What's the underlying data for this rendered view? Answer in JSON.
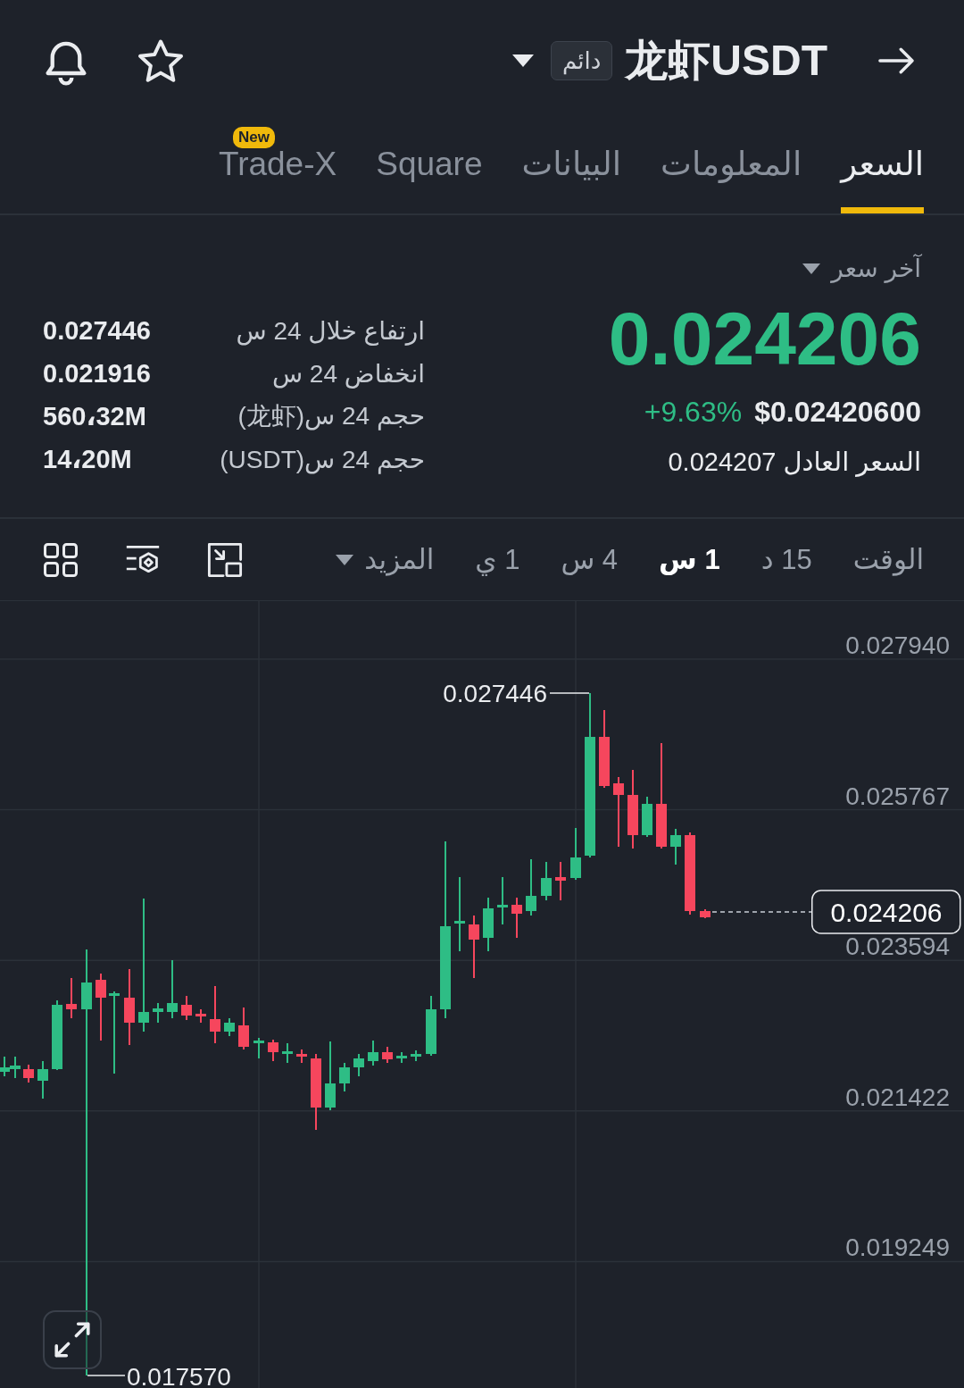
{
  "header": {
    "title": "龙虾USDT",
    "badge": "دائم"
  },
  "tabs": [
    {
      "label": "السعر",
      "selected": true
    },
    {
      "label": "المعلومات",
      "selected": false
    },
    {
      "label": "البيانات",
      "selected": false
    },
    {
      "label": "Square",
      "selected": false
    },
    {
      "label": "Trade-X",
      "selected": false,
      "badge": "New"
    }
  ],
  "price": {
    "label": "آخر سعر",
    "last_price": "0.024206",
    "change": "+9.63%",
    "usd_price": "$0.02420600",
    "fair_price": "السعر العادل 0.024207"
  },
  "stats": [
    {
      "label": "ارتفاع خلال 24 س",
      "value": "0.027446"
    },
    {
      "label": "انخفاض 24 س",
      "value": "0.021916"
    },
    {
      "label": "حجم 24 س(龙虾)",
      "value": "560،32M"
    },
    {
      "label": "حجم 24 س(USDT)",
      "value": "14،20M"
    }
  ],
  "toolbar": {
    "label": "الوقت",
    "intervals": [
      {
        "label": "15 د",
        "selected": false
      },
      {
        "label": "1 س",
        "selected": true
      },
      {
        "label": "4 س",
        "selected": false
      },
      {
        "label": "1 ي",
        "selected": false
      }
    ],
    "more": "المزيد"
  },
  "chart": {
    "y_labels": [
      "0.027940",
      "0.025767",
      "0.023594",
      "0.021422",
      "0.019249"
    ],
    "high_label": "0.027446",
    "low_label": "0.017570",
    "current_price": "0.024206"
  }
}
